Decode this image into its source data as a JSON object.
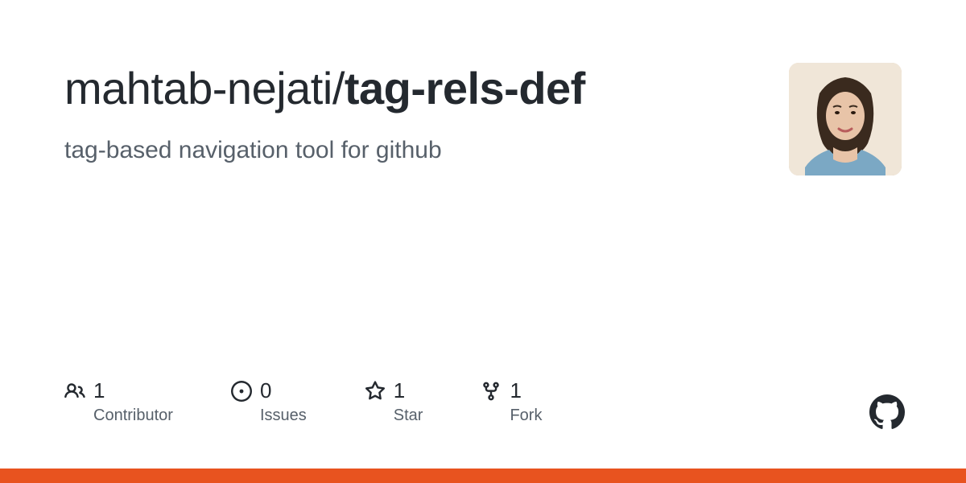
{
  "repo": {
    "owner": "mahtab-nejati",
    "separator": "/",
    "name": "tag-rels-def",
    "description": "tag-based navigation tool for github"
  },
  "stats": [
    {
      "icon": "people-icon",
      "count": "1",
      "label": "Contributor"
    },
    {
      "icon": "issue-icon",
      "count": "0",
      "label": "Issues"
    },
    {
      "icon": "star-icon",
      "count": "1",
      "label": "Star"
    },
    {
      "icon": "fork-icon",
      "count": "1",
      "label": "Fork"
    }
  ],
  "colors": {
    "accent_bar": "#e8531f",
    "text_primary": "#24292f",
    "text_secondary": "#57606a"
  }
}
